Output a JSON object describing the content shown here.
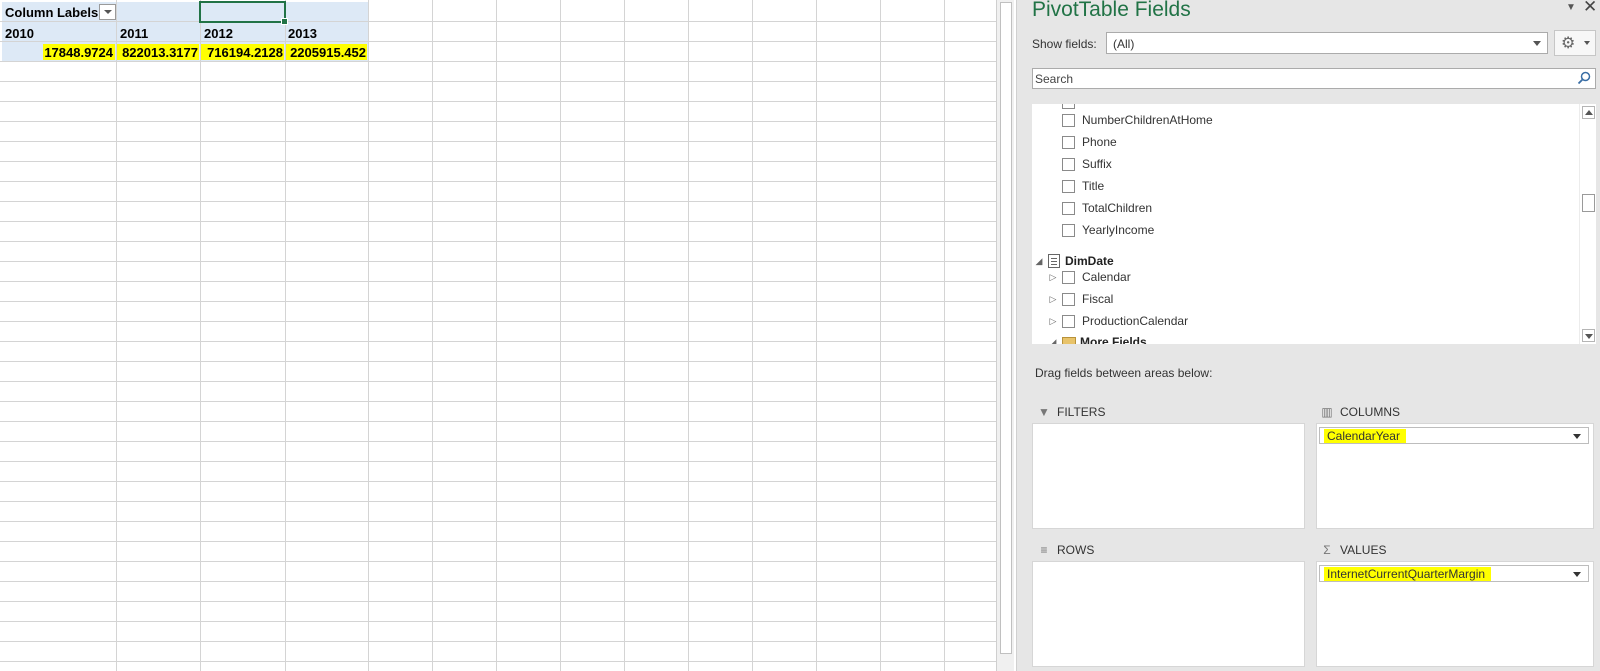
{
  "pivot": {
    "column_labels": "Column Labels",
    "years": [
      "2010",
      "2011",
      "2012",
      "2013"
    ],
    "values": [
      "17848.9724",
      "822013.3177",
      "716194.2128",
      "2205915.452"
    ],
    "highlight_color": "#ffff00",
    "header_bg": "#dde9f6"
  },
  "pane": {
    "title": "PivotTable Fields",
    "show_fields_label": "Show fields:",
    "show_fields_value": "(All)",
    "search_placeholder": "Search",
    "fields": [
      "NumberChildrenAtHome",
      "Phone",
      "Suffix",
      "Title",
      "TotalChildren",
      "YearlyIncome"
    ],
    "table_name": "DimDate",
    "date_fields": [
      "Calendar",
      "Fiscal",
      "ProductionCalendar"
    ],
    "more_fields": "More Fields",
    "drag_label": "Drag fields between areas below:",
    "areas": {
      "filters": "FILTERS",
      "columns": "COLUMNS",
      "rows": "ROWS",
      "values": "VALUES"
    },
    "columns_field": "CalendarYear",
    "values_field": "InternetCurrentQuarterMargin",
    "accent_color": "#217346"
  }
}
